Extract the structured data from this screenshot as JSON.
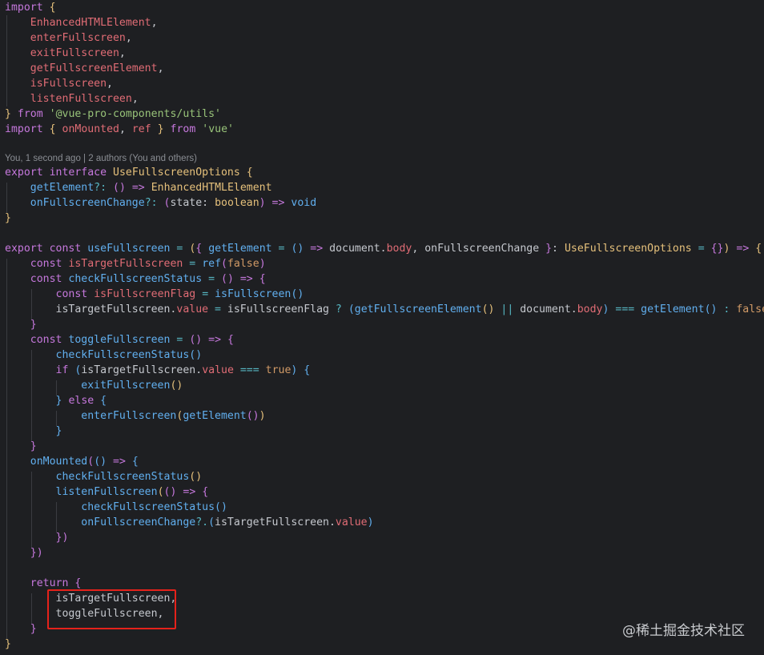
{
  "code": {
    "l1": [
      [
        "kw",
        "import"
      ],
      [
        "plain",
        " "
      ],
      [
        "brace1",
        "{"
      ]
    ],
    "l2": [
      [
        "plain",
        "    "
      ],
      [
        "var",
        "EnhancedHTMLElement"
      ],
      [
        "plain",
        ","
      ]
    ],
    "l3": [
      [
        "plain",
        "    "
      ],
      [
        "var",
        "enterFullscreen"
      ],
      [
        "plain",
        ","
      ]
    ],
    "l4": [
      [
        "plain",
        "    "
      ],
      [
        "var",
        "exitFullscreen"
      ],
      [
        "plain",
        ","
      ]
    ],
    "l5": [
      [
        "plain",
        "    "
      ],
      [
        "var",
        "getFullscreenElement"
      ],
      [
        "plain",
        ","
      ]
    ],
    "l6": [
      [
        "plain",
        "    "
      ],
      [
        "var",
        "isFullscreen"
      ],
      [
        "plain",
        ","
      ]
    ],
    "l7": [
      [
        "plain",
        "    "
      ],
      [
        "var",
        "listenFullscreen"
      ],
      [
        "plain",
        ","
      ]
    ],
    "l8": [
      [
        "brace1",
        "}"
      ],
      [
        "plain",
        " "
      ],
      [
        "kw",
        "from"
      ],
      [
        "plain",
        " "
      ],
      [
        "str",
        "'@vue-pro-components/utils'"
      ]
    ],
    "l9": [
      [
        "kw",
        "import"
      ],
      [
        "plain",
        " "
      ],
      [
        "brace1",
        "{"
      ],
      [
        "plain",
        " "
      ],
      [
        "var",
        "onMounted"
      ],
      [
        "plain",
        ", "
      ],
      [
        "var",
        "ref"
      ],
      [
        "plain",
        " "
      ],
      [
        "brace1",
        "}"
      ],
      [
        "plain",
        " "
      ],
      [
        "kw",
        "from"
      ],
      [
        "plain",
        " "
      ],
      [
        "str",
        "'vue'"
      ]
    ],
    "blame": "You, 1 second ago | 2 authors (You and others)",
    "l11": [
      [
        "kw",
        "export"
      ],
      [
        "plain",
        " "
      ],
      [
        "kw",
        "interface"
      ],
      [
        "plain",
        " "
      ],
      [
        "type",
        "UseFullscreenOptions"
      ],
      [
        "plain",
        " "
      ],
      [
        "brace1",
        "{"
      ]
    ],
    "l12": [
      [
        "plain",
        "    "
      ],
      [
        "fn",
        "getElement"
      ],
      [
        "op",
        "?:"
      ],
      [
        "plain",
        " "
      ],
      [
        "brace2",
        "()"
      ],
      [
        "plain",
        " "
      ],
      [
        "kw",
        "=>"
      ],
      [
        "plain",
        " "
      ],
      [
        "type",
        "EnhancedHTMLElement"
      ]
    ],
    "l13": [
      [
        "plain",
        "    "
      ],
      [
        "fn",
        "onFullscreenChange"
      ],
      [
        "op",
        "?:"
      ],
      [
        "plain",
        " "
      ],
      [
        "brace2",
        "("
      ],
      [
        "plain",
        "state: "
      ],
      [
        "type",
        "boolean"
      ],
      [
        "brace2",
        ")"
      ],
      [
        "plain",
        " "
      ],
      [
        "kw",
        "=>"
      ],
      [
        "plain",
        " "
      ],
      [
        "fn",
        "void"
      ]
    ],
    "l14": [
      [
        "brace1",
        "}"
      ]
    ],
    "l16": [
      [
        "kw",
        "export"
      ],
      [
        "plain",
        " "
      ],
      [
        "kw",
        "const"
      ],
      [
        "plain",
        " "
      ],
      [
        "fn",
        "useFullscreen"
      ],
      [
        "plain",
        " "
      ],
      [
        "op",
        "="
      ],
      [
        "plain",
        " "
      ],
      [
        "brace1",
        "("
      ],
      [
        "brace2",
        "{"
      ],
      [
        "plain",
        " "
      ],
      [
        "fn",
        "getElement"
      ],
      [
        "plain",
        " "
      ],
      [
        "op",
        "="
      ],
      [
        "plain",
        " "
      ],
      [
        "brace3",
        "()"
      ],
      [
        "plain",
        " "
      ],
      [
        "kw",
        "=>"
      ],
      [
        "plain",
        " document."
      ],
      [
        "var",
        "body"
      ],
      [
        "plain",
        ", onFullscreenChange "
      ],
      [
        "brace2",
        "}"
      ],
      [
        "plain",
        ": "
      ],
      [
        "type",
        "UseFullscreenOptions"
      ],
      [
        "plain",
        " "
      ],
      [
        "op",
        "="
      ],
      [
        "plain",
        " "
      ],
      [
        "brace2",
        "{}"
      ],
      [
        "brace1",
        ")"
      ],
      [
        "plain",
        " "
      ],
      [
        "kw",
        "=>"
      ],
      [
        "plain",
        " "
      ],
      [
        "brace1",
        "{"
      ]
    ],
    "l17": [
      [
        "plain",
        "    "
      ],
      [
        "kw",
        "const"
      ],
      [
        "plain",
        " "
      ],
      [
        "var",
        "isTargetFullscreen"
      ],
      [
        "plain",
        " "
      ],
      [
        "op",
        "="
      ],
      [
        "plain",
        " "
      ],
      [
        "fn",
        "ref"
      ],
      [
        "brace2",
        "("
      ],
      [
        "num",
        "false"
      ],
      [
        "brace2",
        ")"
      ]
    ],
    "l18": [
      [
        "plain",
        "    "
      ],
      [
        "kw",
        "const"
      ],
      [
        "plain",
        " "
      ],
      [
        "fn",
        "checkFullscreenStatus"
      ],
      [
        "plain",
        " "
      ],
      [
        "op",
        "="
      ],
      [
        "plain",
        " "
      ],
      [
        "brace2",
        "()"
      ],
      [
        "plain",
        " "
      ],
      [
        "kw",
        "=>"
      ],
      [
        "plain",
        " "
      ],
      [
        "brace2",
        "{"
      ]
    ],
    "l19": [
      [
        "plain",
        "        "
      ],
      [
        "kw",
        "const"
      ],
      [
        "plain",
        " "
      ],
      [
        "var",
        "isFullscreenFlag"
      ],
      [
        "plain",
        " "
      ],
      [
        "op",
        "="
      ],
      [
        "plain",
        " "
      ],
      [
        "fn",
        "isFullscreen"
      ],
      [
        "brace3",
        "()"
      ]
    ],
    "l20": [
      [
        "plain",
        "        isTargetFullscreen."
      ],
      [
        "var",
        "value"
      ],
      [
        "plain",
        " "
      ],
      [
        "op",
        "="
      ],
      [
        "plain",
        " isFullscreenFlag "
      ],
      [
        "op",
        "?"
      ],
      [
        "plain",
        " "
      ],
      [
        "brace3",
        "("
      ],
      [
        "fn",
        "getFullscreenElement"
      ],
      [
        "brace1",
        "()"
      ],
      [
        "plain",
        " "
      ],
      [
        "op",
        "||"
      ],
      [
        "plain",
        " document."
      ],
      [
        "var",
        "body"
      ],
      [
        "brace3",
        ")"
      ],
      [
        "plain",
        " "
      ],
      [
        "op",
        "==="
      ],
      [
        "plain",
        " "
      ],
      [
        "fn",
        "getElement"
      ],
      [
        "brace3",
        "()"
      ],
      [
        "plain",
        " "
      ],
      [
        "op",
        ":"
      ],
      [
        "plain",
        " "
      ],
      [
        "num",
        "false"
      ]
    ],
    "l21": [
      [
        "plain",
        "    "
      ],
      [
        "brace2",
        "}"
      ]
    ],
    "l22": [
      [
        "plain",
        "    "
      ],
      [
        "kw",
        "const"
      ],
      [
        "plain",
        " "
      ],
      [
        "fn",
        "toggleFullscreen"
      ],
      [
        "plain",
        " "
      ],
      [
        "op",
        "="
      ],
      [
        "plain",
        " "
      ],
      [
        "brace2",
        "()"
      ],
      [
        "plain",
        " "
      ],
      [
        "kw",
        "=>"
      ],
      [
        "plain",
        " "
      ],
      [
        "brace2",
        "{"
      ]
    ],
    "l23": [
      [
        "plain",
        "        "
      ],
      [
        "fn",
        "checkFullscreenStatus"
      ],
      [
        "brace3",
        "()"
      ]
    ],
    "l24": [
      [
        "plain",
        "        "
      ],
      [
        "kw",
        "if"
      ],
      [
        "plain",
        " "
      ],
      [
        "brace3",
        "("
      ],
      [
        "plain",
        "isTargetFullscreen."
      ],
      [
        "var",
        "value"
      ],
      [
        "plain",
        " "
      ],
      [
        "op",
        "==="
      ],
      [
        "plain",
        " "
      ],
      [
        "num",
        "true"
      ],
      [
        "brace3",
        ")"
      ],
      [
        "plain",
        " "
      ],
      [
        "brace3",
        "{"
      ]
    ],
    "l25": [
      [
        "plain",
        "            "
      ],
      [
        "fn",
        "exitFullscreen"
      ],
      [
        "brace1",
        "()"
      ]
    ],
    "l26": [
      [
        "plain",
        "        "
      ],
      [
        "brace3",
        "}"
      ],
      [
        "plain",
        " "
      ],
      [
        "kw",
        "else"
      ],
      [
        "plain",
        " "
      ],
      [
        "brace3",
        "{"
      ]
    ],
    "l27": [
      [
        "plain",
        "            "
      ],
      [
        "fn",
        "enterFullscreen"
      ],
      [
        "brace1",
        "("
      ],
      [
        "fn",
        "getElement"
      ],
      [
        "brace2",
        "()"
      ],
      [
        "brace1",
        ")"
      ]
    ],
    "l28": [
      [
        "plain",
        "        "
      ],
      [
        "brace3",
        "}"
      ]
    ],
    "l29": [
      [
        "plain",
        "    "
      ],
      [
        "brace2",
        "}"
      ]
    ],
    "l30": [
      [
        "plain",
        "    "
      ],
      [
        "fn",
        "onMounted"
      ],
      [
        "brace2",
        "("
      ],
      [
        "brace3",
        "()"
      ],
      [
        "plain",
        " "
      ],
      [
        "kw",
        "=>"
      ],
      [
        "plain",
        " "
      ],
      [
        "brace3",
        "{"
      ]
    ],
    "l31": [
      [
        "plain",
        "        "
      ],
      [
        "fn",
        "checkFullscreenStatus"
      ],
      [
        "brace1",
        "()"
      ]
    ],
    "l32": [
      [
        "plain",
        "        "
      ],
      [
        "fn",
        "listenFullscreen"
      ],
      [
        "brace1",
        "("
      ],
      [
        "brace2",
        "()"
      ],
      [
        "plain",
        " "
      ],
      [
        "kw",
        "=>"
      ],
      [
        "plain",
        " "
      ],
      [
        "brace2",
        "{"
      ]
    ],
    "l33": [
      [
        "plain",
        "            "
      ],
      [
        "fn",
        "checkFullscreenStatus"
      ],
      [
        "brace3",
        "()"
      ]
    ],
    "l34": [
      [
        "plain",
        "            "
      ],
      [
        "fn",
        "onFullscreenChange"
      ],
      [
        "op",
        "?."
      ],
      [
        "brace3",
        "("
      ],
      [
        "plain",
        "isTargetFullscreen."
      ],
      [
        "var",
        "value"
      ],
      [
        "brace3",
        ")"
      ]
    ],
    "l35": [
      [
        "plain",
        "        "
      ],
      [
        "brace2",
        "})"
      ]
    ],
    "l36": [
      [
        "plain",
        "    "
      ],
      [
        "brace2",
        "})"
      ]
    ],
    "l38": [
      [
        "plain",
        "    "
      ],
      [
        "kw",
        "return"
      ],
      [
        "plain",
        " "
      ],
      [
        "brace2",
        "{"
      ]
    ],
    "l39": [
      [
        "plain",
        "        isTargetFullscreen,"
      ]
    ],
    "l40": [
      [
        "plain",
        "        toggleFullscreen,"
      ]
    ],
    "l41": [
      [
        "plain",
        "    "
      ],
      [
        "brace2",
        "}"
      ]
    ],
    "l42": [
      [
        "brace1",
        "}"
      ]
    ]
  },
  "colors": {
    "keyword": "#c678dd",
    "function": "#61afef",
    "variable": "#e06c75",
    "string": "#98c379",
    "type": "#e5c07b",
    "highlight_box": "#e5221b"
  },
  "watermark": "@稀土掘金技术社区"
}
